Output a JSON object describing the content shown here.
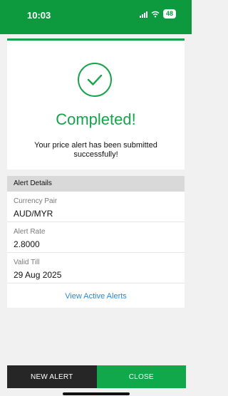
{
  "status_bar": {
    "time": "10:03",
    "battery": "48",
    "icons": [
      "signal-icon",
      "wifi-icon",
      "battery-icon"
    ]
  },
  "confirmation": {
    "icon": "check-circle-icon",
    "title": "Completed!",
    "message": "Your price alert has been submitted successfully!",
    "accent_color": "#17a34a"
  },
  "alert_details": {
    "header": "Alert Details",
    "fields": [
      {
        "label": "Currency Pair",
        "value": "AUD/MYR"
      },
      {
        "label": "Alert Rate",
        "value": "2.8000"
      },
      {
        "label": "Valid Till",
        "value": "29 Aug 2025"
      }
    ],
    "link": "View Active Alerts",
    "link_color": "#2a8ad6"
  },
  "actions": {
    "new_alert": "NEW ALERT",
    "close": "CLOSE"
  }
}
